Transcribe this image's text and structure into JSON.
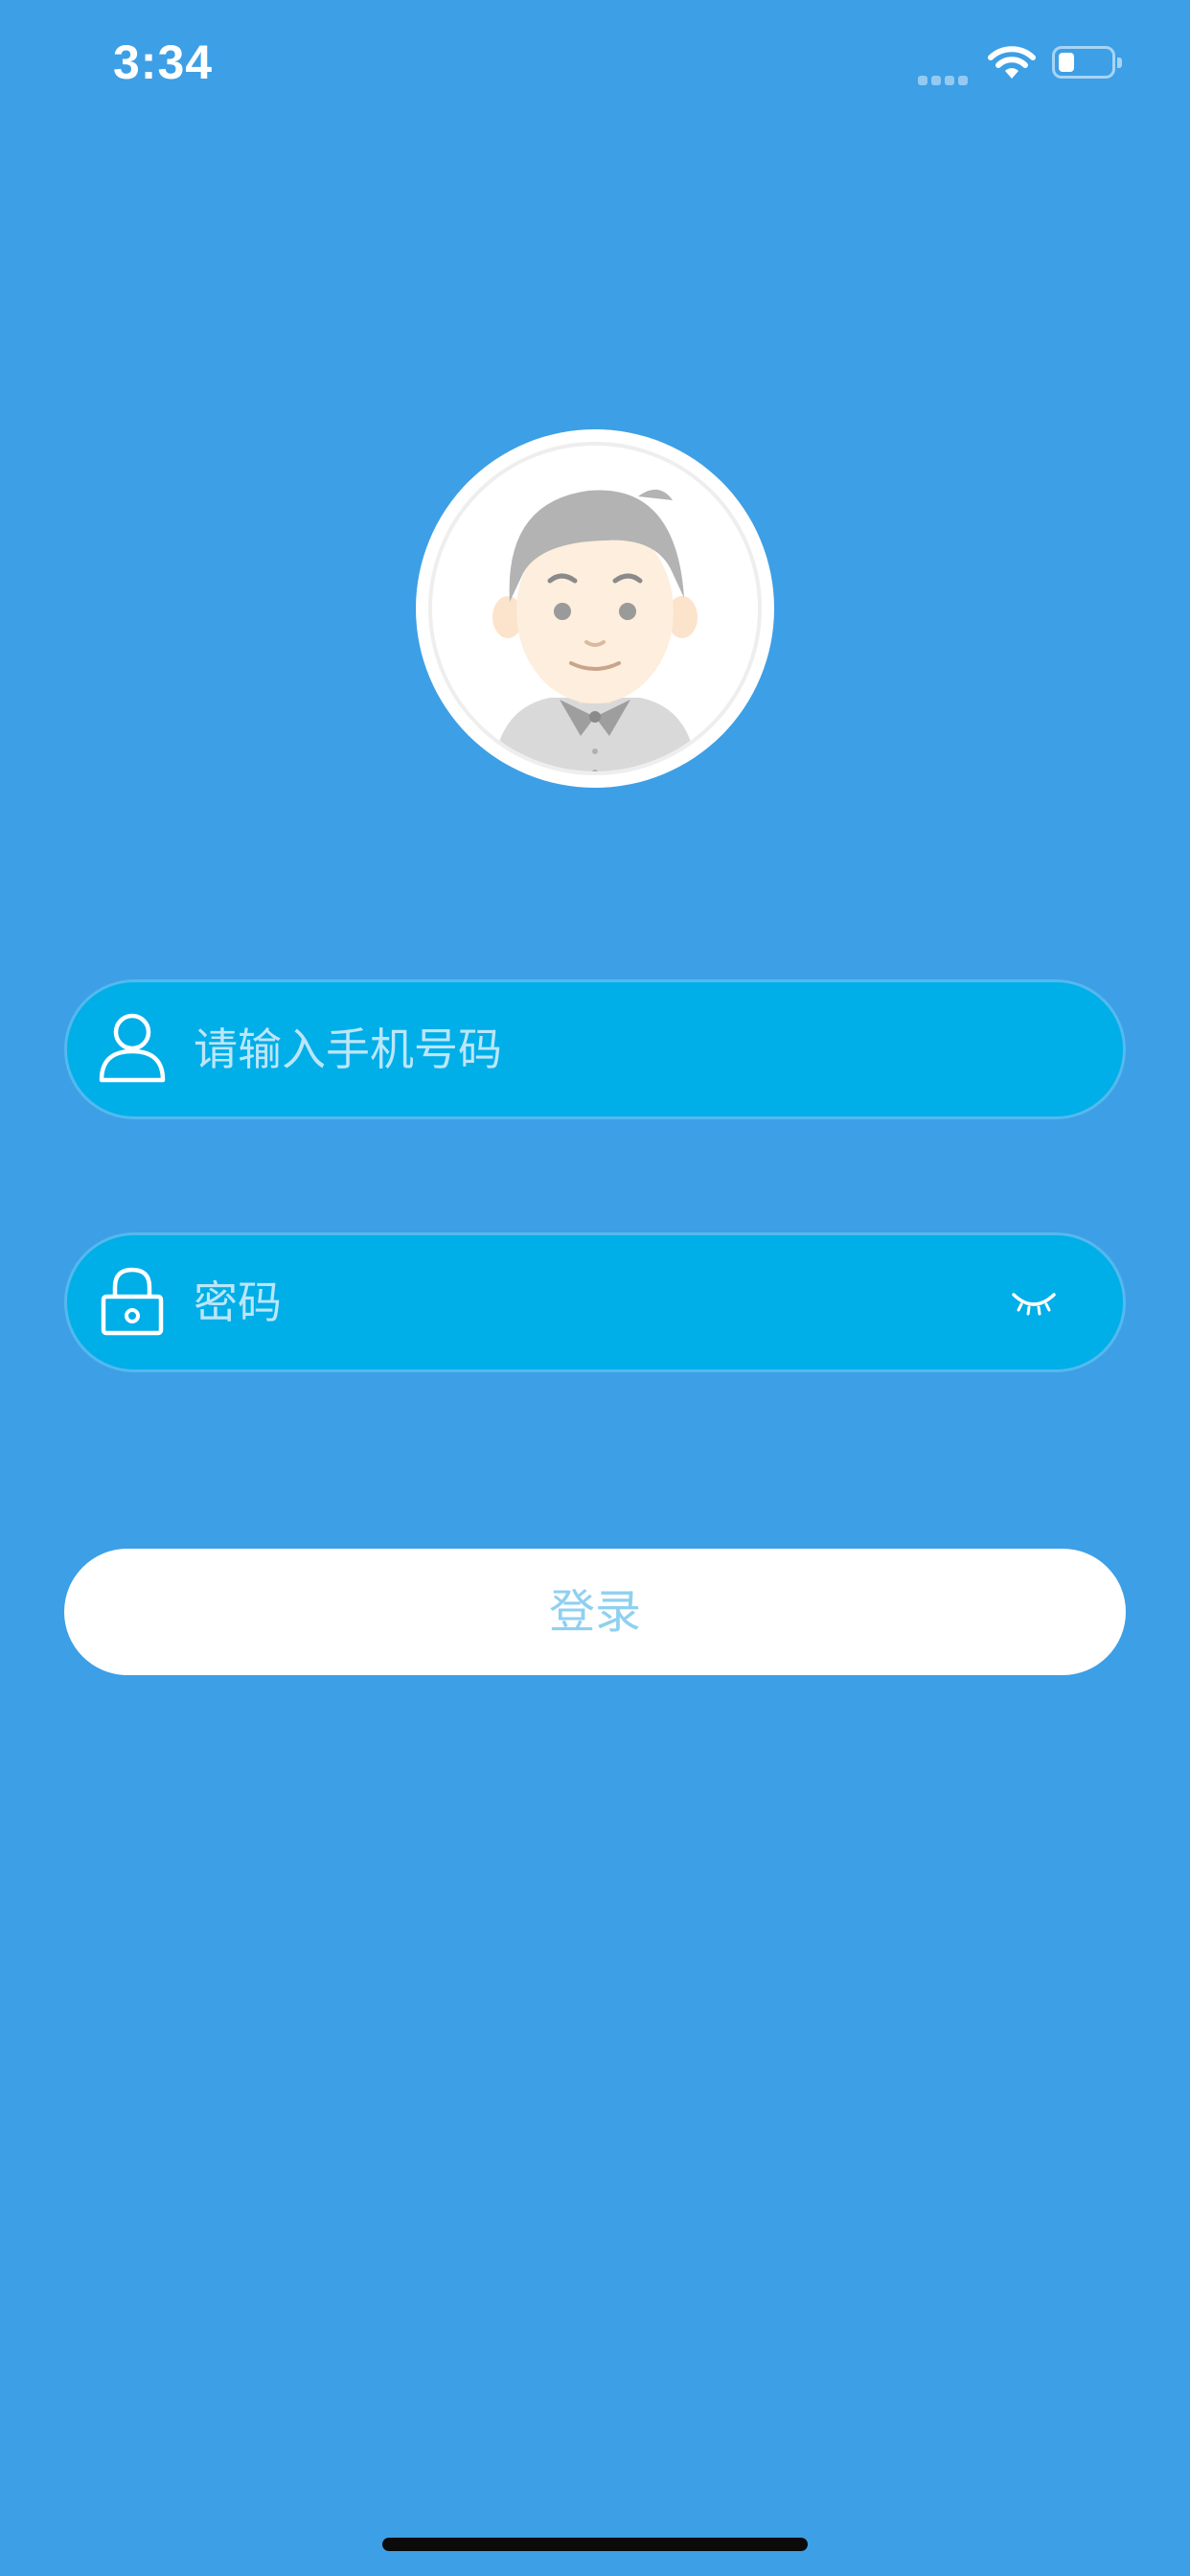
{
  "status_bar": {
    "time": "3:34"
  },
  "login_form": {
    "phone_placeholder": "请输入手机号码",
    "password_placeholder": "密码",
    "login_label": "登录"
  },
  "icons": {
    "phone_field": "user-icon",
    "password_field": "lock-icon",
    "password_toggle": "eye-closed-icon"
  },
  "colors": {
    "background": "#3d9fe6",
    "field_background": "#00aee8",
    "button_background": "#ffffff",
    "button_text": "#8fd0f0"
  }
}
